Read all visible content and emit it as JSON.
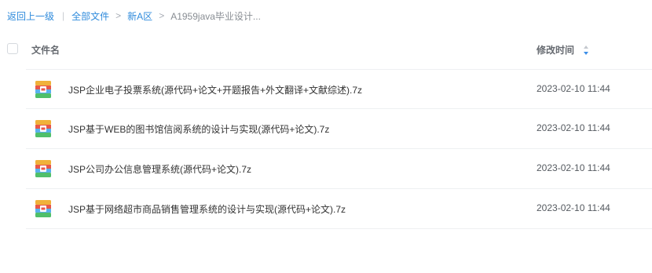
{
  "breadcrumb": {
    "back": "返回上一级",
    "pipe": "|",
    "items": [
      "全部文件",
      "新A区",
      "A1959java毕业设计..."
    ],
    "separator": ">"
  },
  "header": {
    "name_label": "文件名",
    "time_label": "修改时间"
  },
  "colors": {
    "link": "#2f8bdc",
    "sort_active": "#3b8ee8"
  },
  "files": [
    {
      "icon": "archive-file-icon",
      "name": "JSP企业电子投票系统(源代码+论文+开题报告+外文翻译+文献综述).7z",
      "modified": "2023-02-10 11:44"
    },
    {
      "icon": "archive-file-icon",
      "name": "JSP基于WEB的图书馆信阅系统的设计与实现(源代码+论文).7z",
      "modified": "2023-02-10 11:44"
    },
    {
      "icon": "archive-file-icon",
      "name": "JSP公司办公信息管理系统(源代码+论文).7z",
      "modified": "2023-02-10 11:44"
    },
    {
      "icon": "archive-file-icon",
      "name": "JSP基于网络超市商品销售管理系统的设计与实现(源代码+论文).7z",
      "modified": "2023-02-10 11:44"
    }
  ]
}
